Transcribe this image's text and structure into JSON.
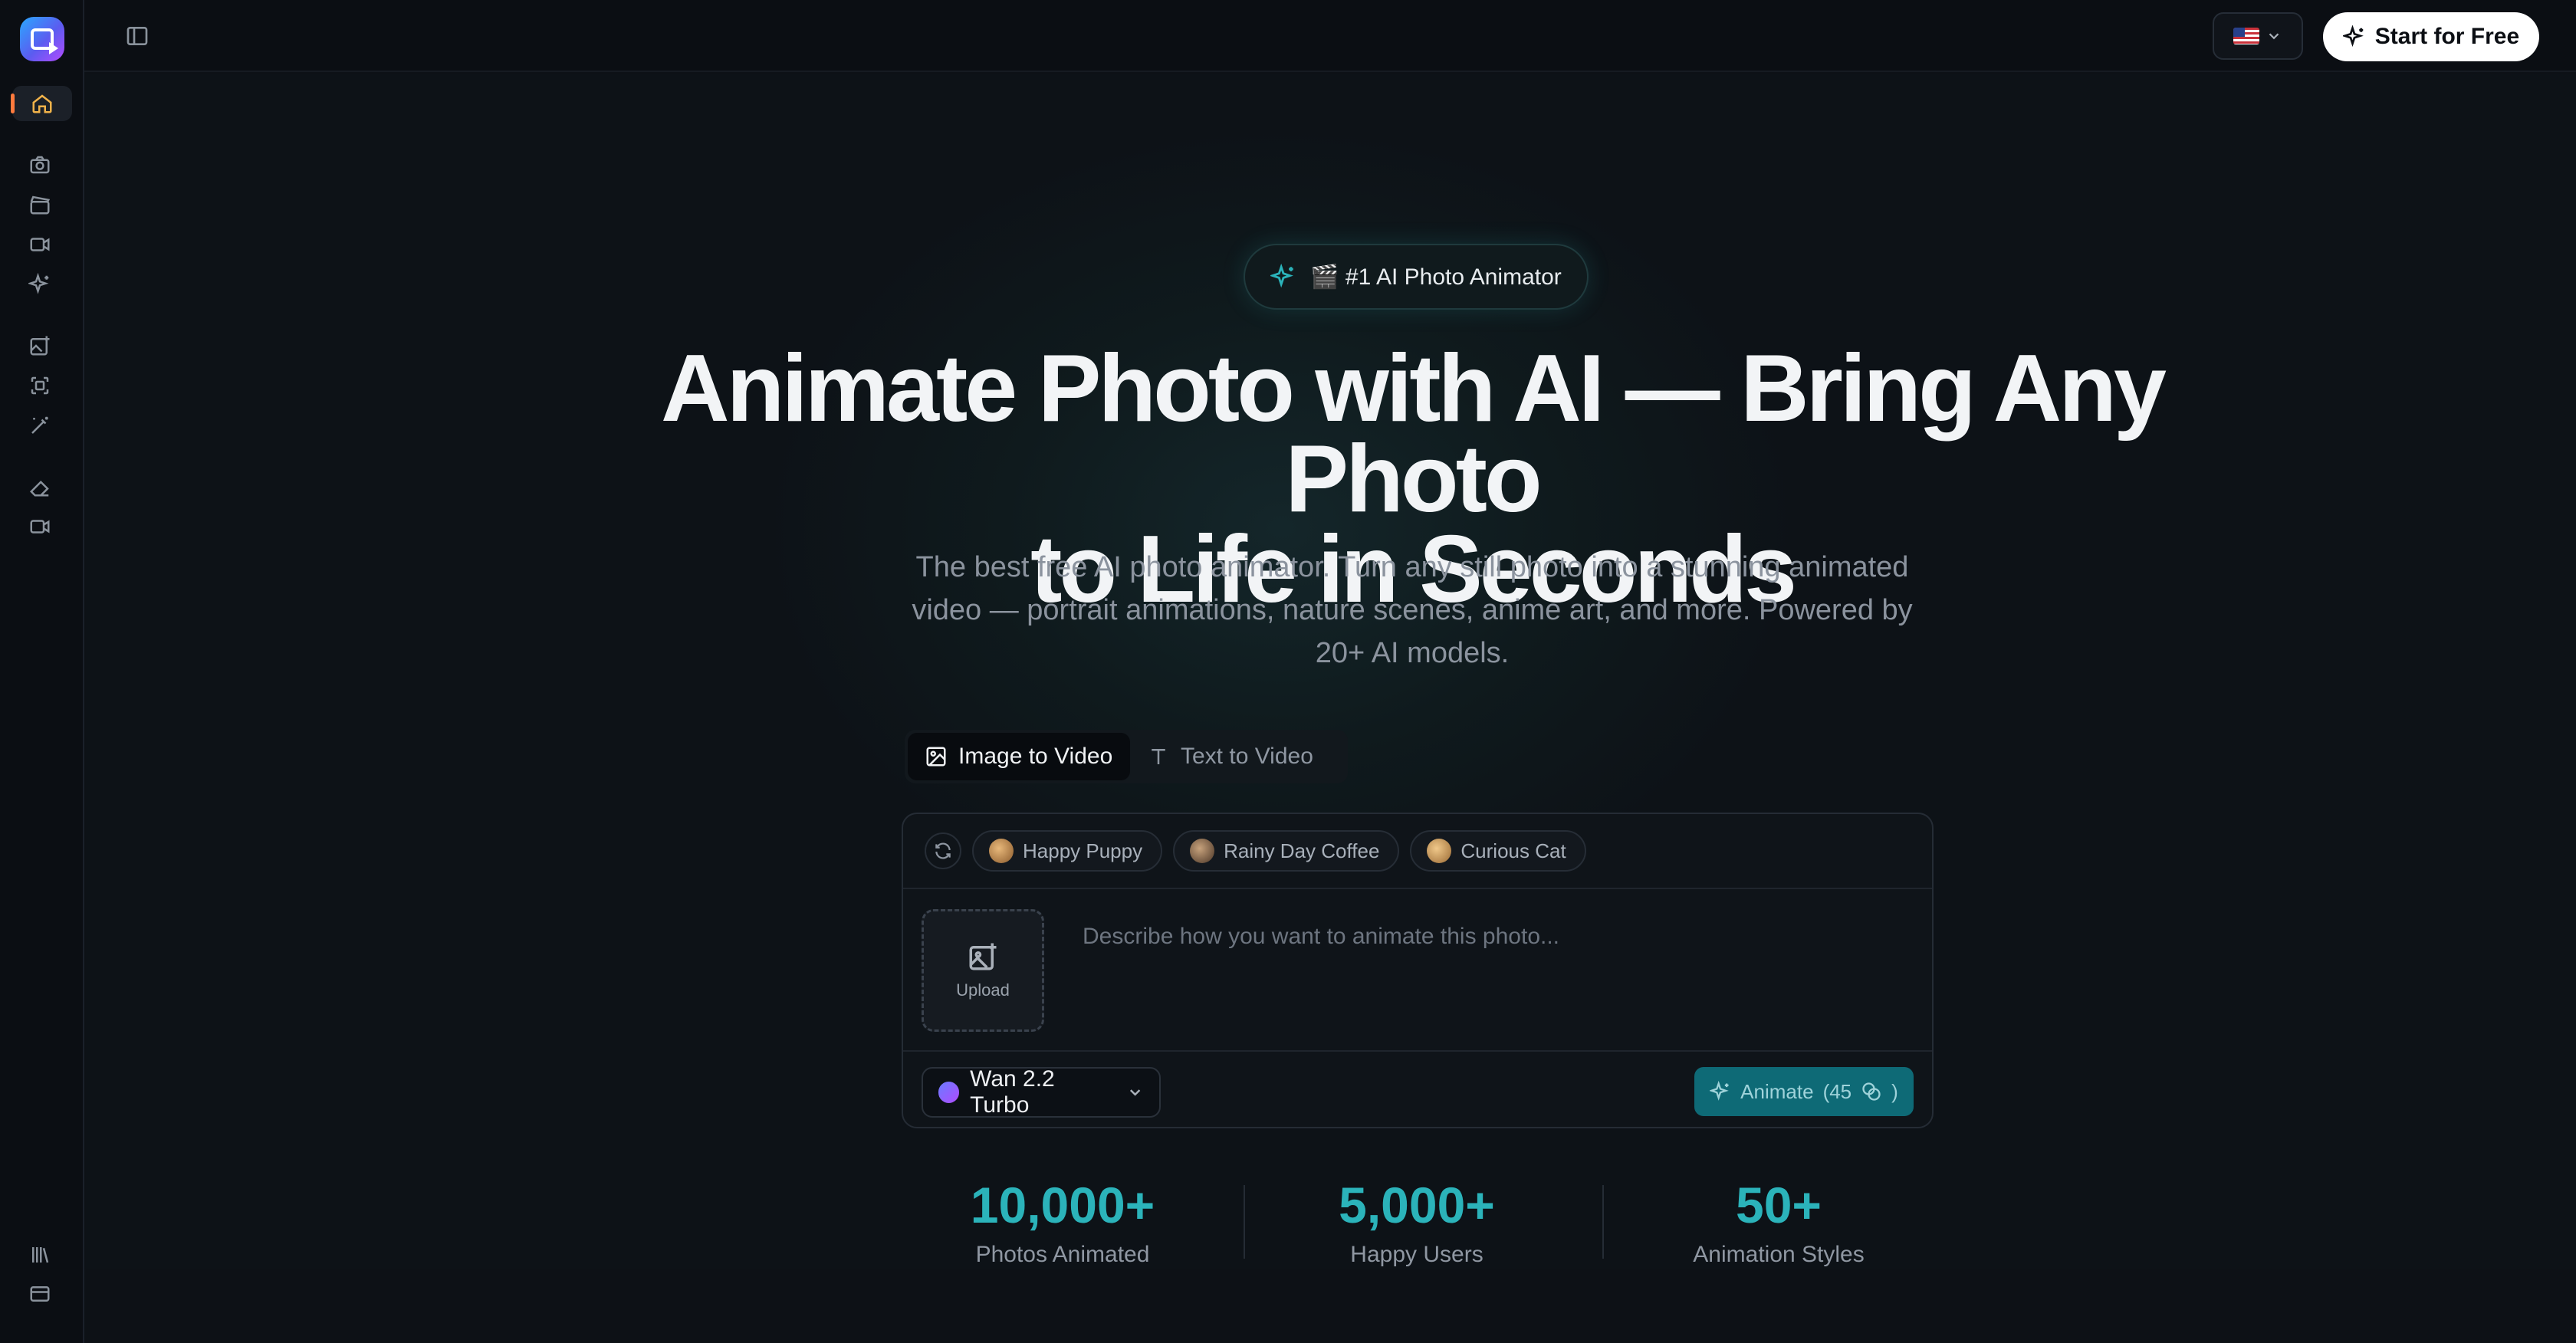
{
  "header": {
    "language_flag": "🇺🇸",
    "start_button": "Start for Free"
  },
  "sidebar": {
    "items": [
      {
        "icon": "home-icon",
        "active": true
      },
      {
        "icon": "camera-icon"
      },
      {
        "icon": "clapperboard-icon"
      },
      {
        "icon": "video-icon"
      },
      {
        "icon": "sparkles-icon"
      },
      {
        "icon": "image-plus-icon"
      },
      {
        "icon": "scan-icon"
      },
      {
        "icon": "magic-wand-icon"
      },
      {
        "icon": "eraser-icon"
      },
      {
        "icon": "video-camera-icon"
      },
      {
        "icon": "library-icon"
      },
      {
        "icon": "credit-card-icon"
      }
    ]
  },
  "hero": {
    "badge": "🎬 #1 AI Photo Animator",
    "title_line1": "Animate Photo with AI — Bring Any Photo",
    "title_line2": "to Life in Seconds",
    "subtitle": "The best free AI photo animator. Turn any still photo into a stunning animated video — portrait animations, nature scenes, anime art, and more. Powered by 20+ AI models."
  },
  "tabs": [
    {
      "label": "Image to Video",
      "active": true
    },
    {
      "label": "Text to Video",
      "active": false
    }
  ],
  "card": {
    "chips": [
      "Happy Puppy",
      "Rainy Day Coffee",
      "Curious Cat"
    ],
    "upload_label": "Upload",
    "prompt_placeholder": "Describe how you want to animate this photo...",
    "model": "Wan 2.2 Turbo",
    "animate_label": "Animate",
    "animate_cost": "(45",
    "animate_cost_close": ")"
  },
  "stats": [
    {
      "value": "10,000+",
      "label": "Photos Animated"
    },
    {
      "value": "5,000+",
      "label": "Happy Users"
    },
    {
      "value": "50+",
      "label": "Animation Styles"
    }
  ],
  "colors": {
    "accent": "#2bb3ba",
    "animate_button": "#0e6a76",
    "active_marker": "#ff7a3d",
    "background": "#0d1116"
  }
}
